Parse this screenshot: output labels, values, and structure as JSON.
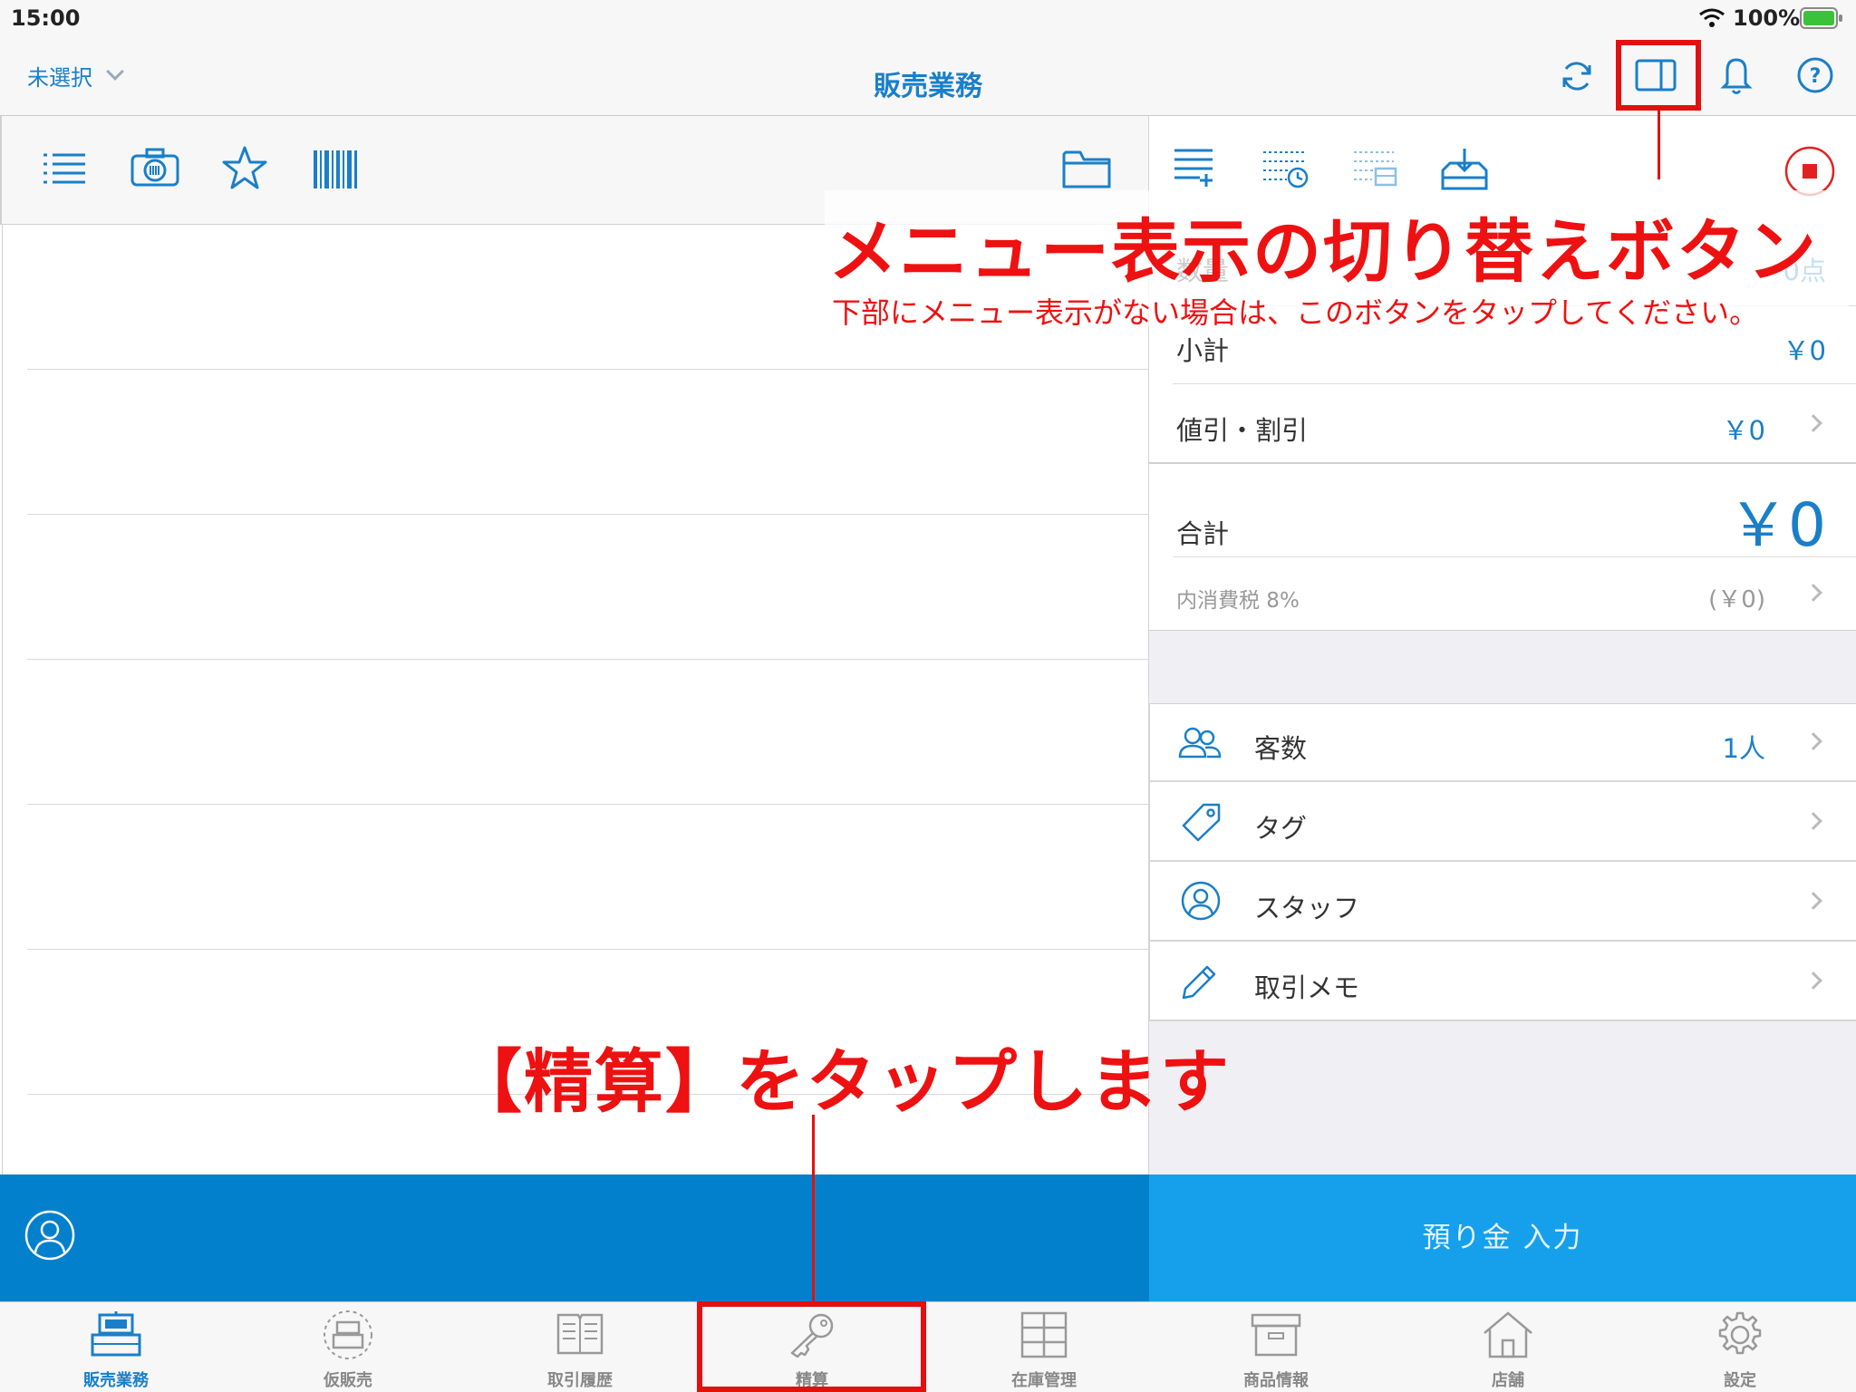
{
  "status_bar": {
    "time": "15:00",
    "battery": "100%"
  },
  "nav": {
    "store_selector": "未選択",
    "title": "販売業務"
  },
  "summary": {
    "quantity_label": "数量",
    "quantity_value": "0点",
    "subtotal_label": "小計",
    "subtotal_value": "￥0",
    "discount_label": "値引・割引",
    "discount_value": "￥0",
    "total_label": "合計",
    "total_value": "￥0",
    "tax_label": "内消費税 8%",
    "tax_value": "(￥0)"
  },
  "options": [
    {
      "label": "客数",
      "value": "1人",
      "icon": "customers-icon"
    },
    {
      "label": "タグ",
      "value": "",
      "icon": "tag-icon"
    },
    {
      "label": "スタッフ",
      "value": "",
      "icon": "staff-icon"
    },
    {
      "label": "取引メモ",
      "value": "",
      "icon": "pencil-icon"
    }
  ],
  "deposit_button": "預り金 入力",
  "tabs": [
    {
      "label": "販売業務",
      "icon": "register-icon"
    },
    {
      "label": "仮販売",
      "icon": "provisional-register-icon"
    },
    {
      "label": "取引履歴",
      "icon": "history-book-icon"
    },
    {
      "label": "精算",
      "icon": "key-icon"
    },
    {
      "label": "在庫管理",
      "icon": "inventory-icon"
    },
    {
      "label": "商品情報",
      "icon": "product-box-icon"
    },
    {
      "label": "店舗",
      "icon": "store-house-icon"
    },
    {
      "label": "設定",
      "icon": "gear-icon"
    }
  ],
  "annotations": {
    "menu_toggle_title": "メニュー表示の切り替えボタン",
    "menu_toggle_note": "下部にメニュー表示がない場合は、このボタンをタップしてください。",
    "settle_instruction": "【精算】をタップします"
  },
  "colors": {
    "accent": "#1a7fc9",
    "bottom_bar": "#0380cc",
    "deposit": "#16a0ec",
    "annotation": "#ee1111"
  }
}
